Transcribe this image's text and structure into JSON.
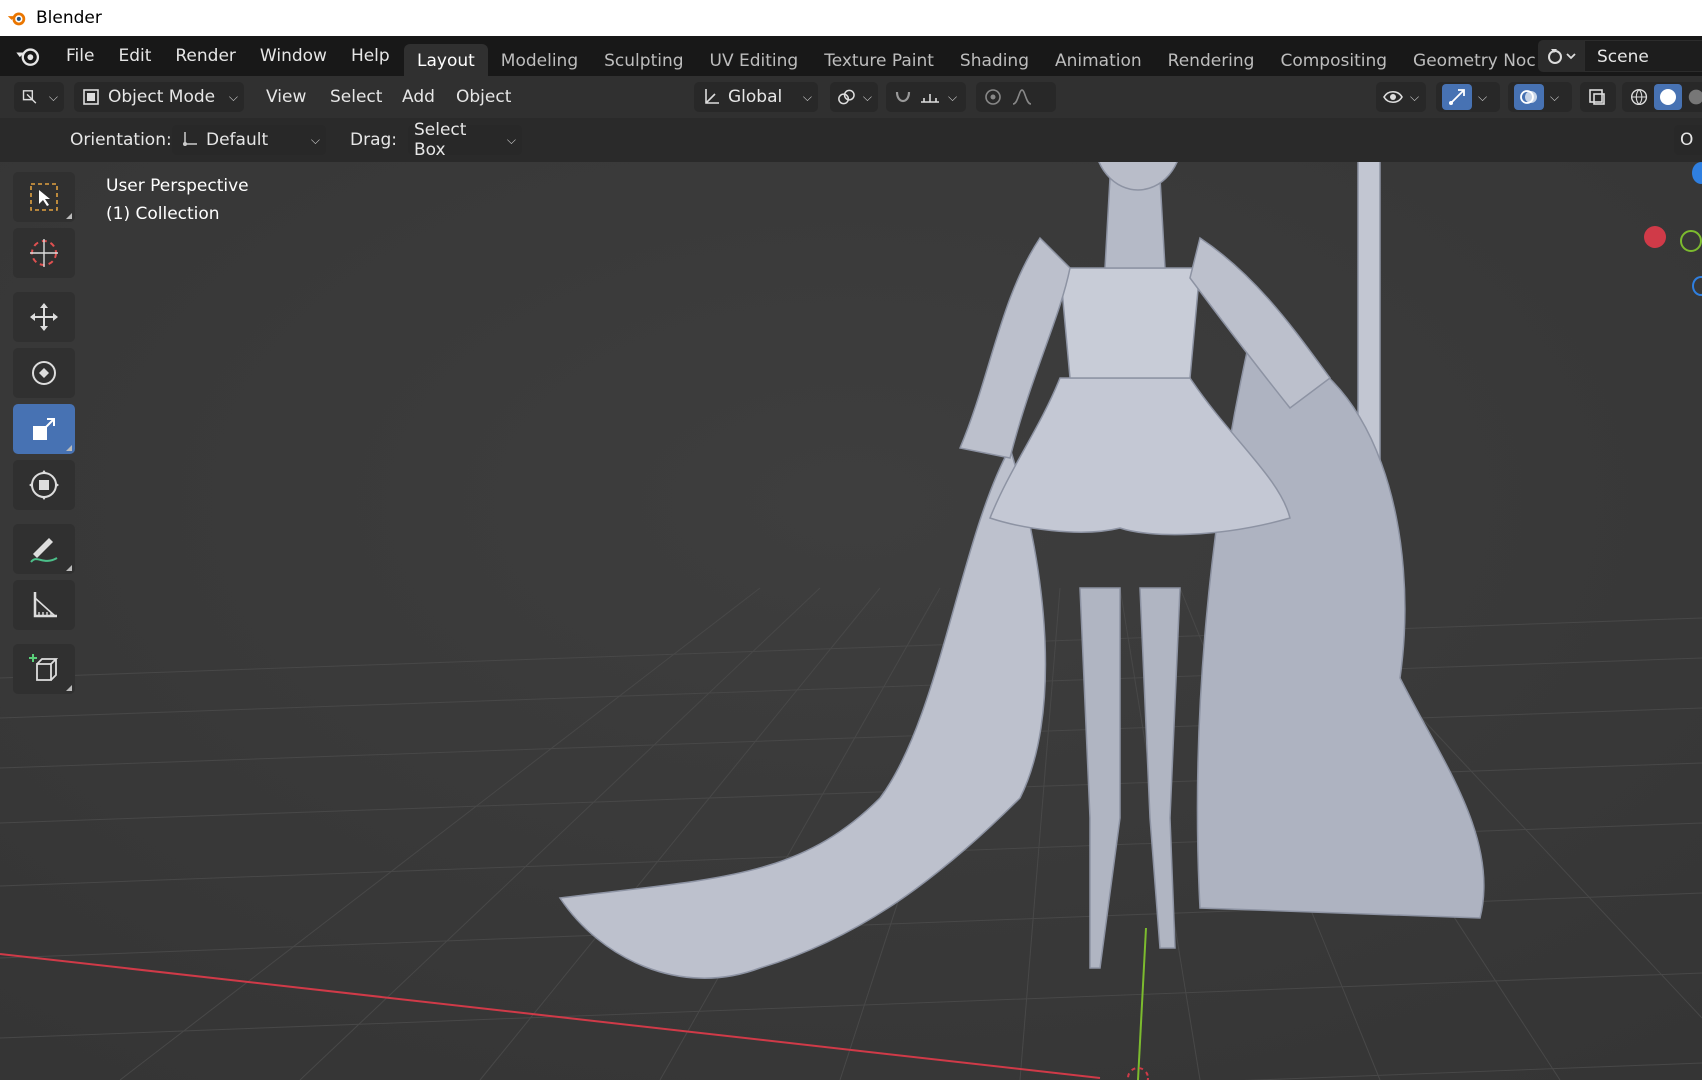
{
  "window": {
    "title": "Blender"
  },
  "menu": {
    "items": [
      "File",
      "Edit",
      "Render",
      "Window",
      "Help"
    ]
  },
  "workspaces": {
    "tabs": [
      "Layout",
      "Modeling",
      "Sculpting",
      "UV Editing",
      "Texture Paint",
      "Shading",
      "Animation",
      "Rendering",
      "Compositing",
      "Geometry Noc"
    ],
    "active": "Layout"
  },
  "scene": {
    "name": "Scene"
  },
  "header": {
    "mode": "Object Mode",
    "view": "View",
    "select": "Select",
    "add": "Add",
    "object": "Object",
    "transform_orientation": "Global"
  },
  "tool_settings": {
    "orientation_label": "Orientation:",
    "orientation_value": "Default",
    "drag_label": "Drag:",
    "drag_value": "Select Box",
    "options_cut": "O"
  },
  "viewport": {
    "perspective": "User Perspective",
    "collection": "(1) Collection"
  },
  "toolbar": {
    "tools": [
      "select-box",
      "cursor",
      "move",
      "rotate",
      "scale",
      "transform",
      "annotate",
      "measure",
      "add-cube"
    ],
    "active": "scale"
  },
  "colors": {
    "accent": "#4772b3",
    "x_axis": "#d03a48",
    "y_axis": "#7cbb2e",
    "z_axis": "#2f7fe0",
    "model": "#b7bcca"
  }
}
